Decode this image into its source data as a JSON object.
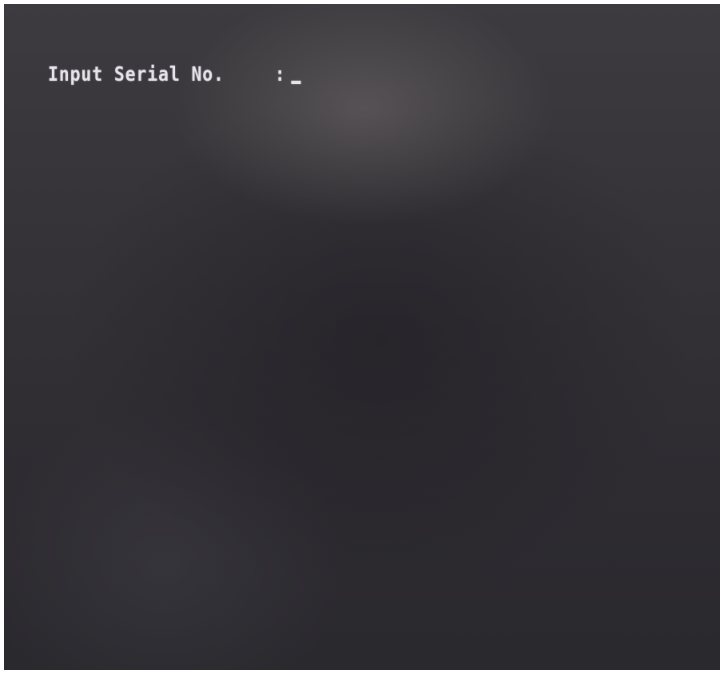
{
  "terminal": {
    "prompt_label": "Input Serial No.",
    "separator": ":",
    "input_value": "",
    "text_color": "#e6e4ea",
    "background_color": "#333136"
  }
}
